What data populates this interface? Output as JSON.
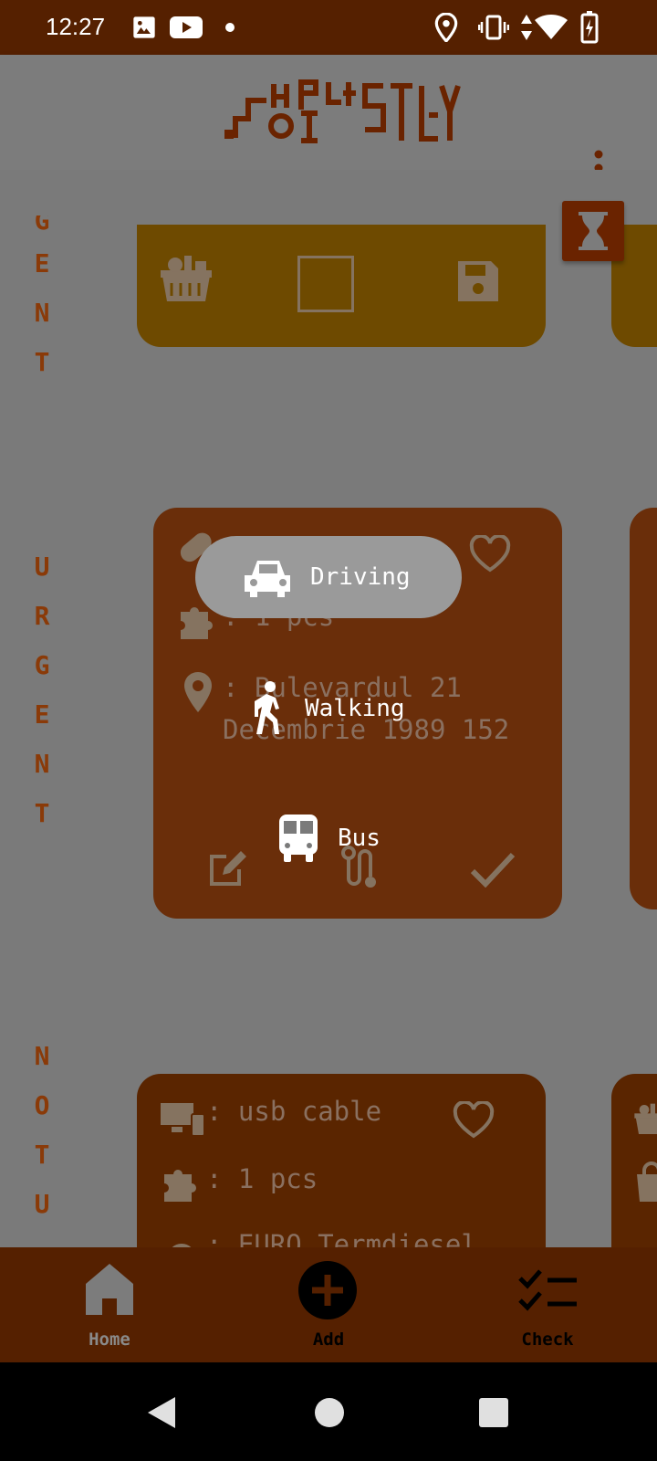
{
  "status_bar": {
    "time": "12:27",
    "icons": [
      "gallery-icon",
      "youtube-icon",
      "dot-icon",
      "location-icon",
      "vibrate-icon",
      "data-arrows-icon",
      "wifi-icon",
      "battery-charging-icon"
    ]
  },
  "app_bar": {
    "logo_text": "ShoPPiSTLY",
    "menu_icon": "more-vert-icon"
  },
  "sections": {
    "urgent_top_fragment": [
      "G",
      "E",
      "N",
      "T"
    ],
    "urgent": [
      "U",
      "R",
      "G",
      "E",
      "N",
      "T"
    ],
    "not_urgent": [
      "N",
      "O",
      "T",
      "U"
    ]
  },
  "cards": {
    "top_card": {
      "icons": [
        "grocery-basket-icon",
        "checkbox-empty-icon",
        "save-icon"
      ]
    },
    "middle_card": {
      "quantity": ": 1 pcs",
      "address_line1": ": Bulevardul 21",
      "address_line2": "Decembrie 1989 152"
    },
    "bottom_card": {
      "item": ": usb cable",
      "quantity": ": 1 pcs",
      "partial": ": EURO Termdiesel"
    }
  },
  "route_menu": {
    "options": [
      {
        "label": "Driving",
        "icon": "car-icon",
        "selected": true
      },
      {
        "label": "Walking",
        "icon": "walk-icon",
        "selected": false
      },
      {
        "label": "Bus",
        "icon": "bus-icon",
        "selected": false
      }
    ]
  },
  "bottom_nav": {
    "home": "Home",
    "add": "Add",
    "check": "Check"
  },
  "colors": {
    "status_bar": "#552000",
    "accent": "#6a2300",
    "card_yellow": "#6e4a00",
    "card_brown": "#6a2e0a",
    "scrim": "#7a7a7a"
  }
}
